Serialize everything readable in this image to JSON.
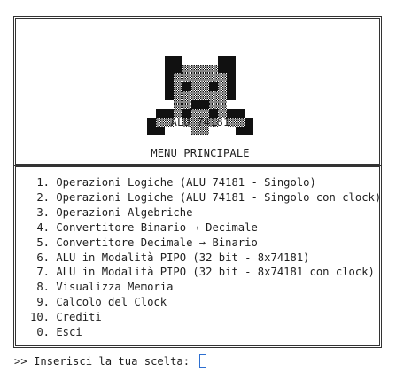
{
  "header": {
    "logo_name": "bear-ascii-art",
    "chip_label": "ALU 74181",
    "menu_title": "MENU PRINCIPALE"
  },
  "menu": {
    "items": [
      {
        "num": "1.",
        "label": "Operazioni Logiche (ALU 74181 - Singolo)"
      },
      {
        "num": "2.",
        "label": "Operazioni Logiche (ALU 74181 - Singolo con clock)"
      },
      {
        "num": "3.",
        "label": "Operazioni Algebriche"
      },
      {
        "num": "4.",
        "label": "Convertitore Binario → Decimale"
      },
      {
        "num": "5.",
        "label": "Convertitore Decimale → Binario"
      },
      {
        "num": "6.",
        "label": "ALU in Modalità PIPO (32 bit - 8x74181)"
      },
      {
        "num": "7.",
        "label": "ALU in Modalità PIPO (32 bit - 8x74181 con clock)"
      },
      {
        "num": "8.",
        "label": "Visualizza Memoria"
      },
      {
        "num": "9.",
        "label": "Calcolo del Clock"
      },
      {
        "num": "10.",
        "label": "Crediti"
      },
      {
        "num": "0.",
        "label": "Esci"
      }
    ]
  },
  "prompt": {
    "text": ">> Inserisci la tua scelta: "
  },
  "colors": {
    "text": "#1f1f1f",
    "frame": "#333333",
    "cursor": "#2d6fd0"
  }
}
